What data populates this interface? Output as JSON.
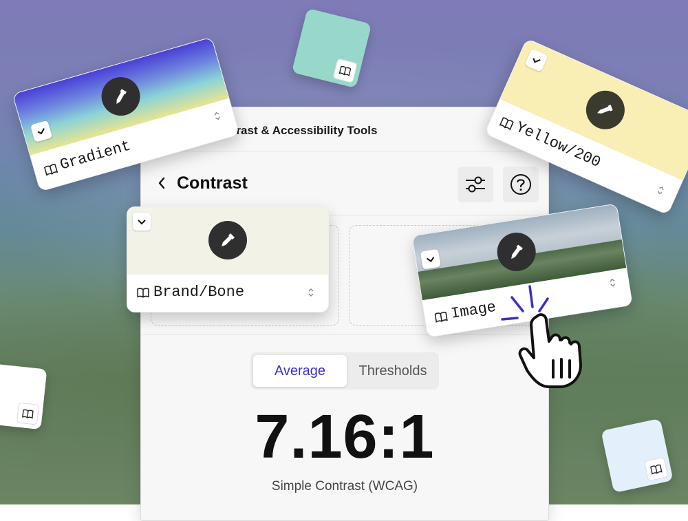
{
  "panel": {
    "title": "ontrast & Accessibility Tools",
    "section_title": "Contrast",
    "tabs": [
      {
        "label": "Average",
        "active": true
      },
      {
        "label": "Thresholds",
        "active": false
      }
    ],
    "ratio": "7.16:1",
    "ratio_label": "Simple Contrast (WCAG)"
  },
  "cards": {
    "gradient": {
      "name": "Gradient"
    },
    "yellow": {
      "name": "Yellow/200",
      "color": "#f9eeb4"
    },
    "bone": {
      "name": "Brand/Bone",
      "color": "#f3f2e6"
    },
    "image": {
      "name": "Image"
    }
  },
  "minis": {
    "teal": "#97d8cb",
    "white": "#ffffff",
    "light_blue": "#e3f0fc"
  },
  "colors": {
    "accent": "#3b2fc9",
    "picker_bg": "#2f2f2f"
  },
  "icons": [
    "chevron-left-icon",
    "sliders-icon",
    "help-icon",
    "eyedropper-icon",
    "book-icon",
    "check-icon",
    "chevron-up-down-icon",
    "hand-pointer-icon"
  ]
}
